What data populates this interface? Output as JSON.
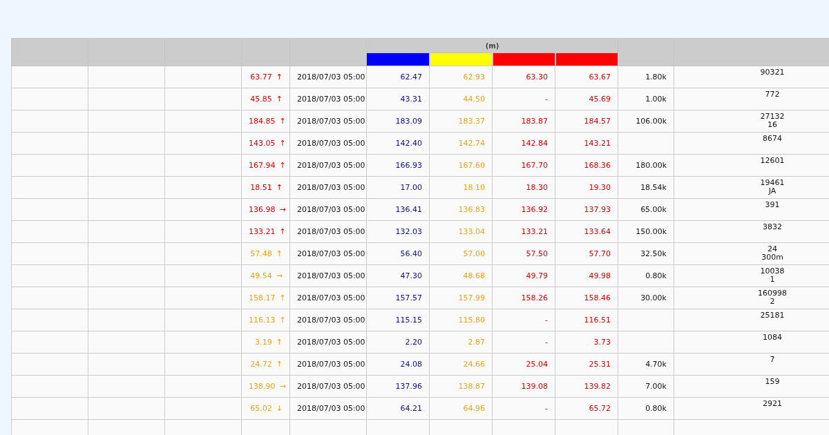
{
  "table": {
    "unit_header": "(m)",
    "thresholds": [
      {
        "color": "#0000ff"
      },
      {
        "color": "#ffff00"
      },
      {
        "color": "#ff0000"
      },
      {
        "color": "#ff0000"
      }
    ],
    "rows": [
      {
        "level_value": "63.77",
        "trend": "↑",
        "color": "#cc0000",
        "time": "2018/07/03 05:00",
        "t1": "62.47",
        "t2": "62.93",
        "t3": "63.30",
        "t4": "63.67",
        "amount": "1.80k",
        "code": [
          "90321"
        ]
      },
      {
        "level_value": "45.85",
        "trend": "↑",
        "color": "#cc0000",
        "time": "2018/07/03 05:00",
        "t1": "43.31",
        "t2": "44.50",
        "t3": "-",
        "t4": "45.69",
        "amount": "1.00k",
        "code": [
          "772"
        ]
      },
      {
        "level_value": "184.85",
        "trend": "↑",
        "color": "#cc0000",
        "time": "2018/07/03 05:00",
        "t1": "183.09",
        "t2": "183.37",
        "t3": "183.87",
        "t4": "184.57",
        "amount": "106.00k",
        "code": [
          "27132",
          "16"
        ]
      },
      {
        "level_value": "143.05",
        "trend": "↑",
        "color": "#cc0000",
        "time": "2018/07/03 05:00",
        "t1": "142.40",
        "t2": "142.74",
        "t3": "142.84",
        "t4": "143.21",
        "code": [
          "8674"
        ]
      },
      {
        "level_value": "167.94",
        "trend": "↑",
        "color": "#cc0000",
        "time": "2018/07/03 05:00",
        "t1": "166.93",
        "t2": "167.60",
        "t3": "167.70",
        "t4": "168.36",
        "amount": "180.00k",
        "code": [
          "12601"
        ]
      },
      {
        "level_value": "18.51",
        "trend": "↑",
        "color": "#cc0000",
        "time": "2018/07/03 05:00",
        "t1": "17.00",
        "t2": "18.10",
        "t3": "18.30",
        "t4": "19.30",
        "amount": "18.54k",
        "code": [
          "19461",
          "JA"
        ]
      },
      {
        "level_value": "136.98",
        "trend": "→",
        "color": "#cc0000",
        "time": "2018/07/03 05:00",
        "t1": "136.41",
        "t2": "136.83",
        "t3": "136.92",
        "t4": "137.93",
        "amount": "65.00k",
        "code": [
          "391"
        ]
      },
      {
        "level_value": "133.21",
        "trend": "↑",
        "color": "#cc0000",
        "time": "2018/07/03 05:00",
        "t1": "132.03",
        "t2": "133.04",
        "t3": "133.21",
        "t4": "133.64",
        "amount": "150.00k",
        "code": [
          "3832"
        ]
      },
      {
        "level_value": "57.48",
        "trend": "↑",
        "color": "#e8a317",
        "time": "2018/07/03 05:00",
        "t1": "56.40",
        "t2": "57.00",
        "t3": "57.50",
        "t4": "57.70",
        "amount": "32.50k",
        "code": [
          "24",
          "300m"
        ]
      },
      {
        "level_value": "49.54",
        "trend": "→",
        "color": "#e8a317",
        "time": "2018/07/03 05:00",
        "t1": "47.30",
        "t2": "48.68",
        "t3": "49.79",
        "t4": "49.98",
        "amount": "0.80k",
        "code": [
          "10038",
          "1"
        ]
      },
      {
        "level_value": "158.17",
        "trend": "↑",
        "color": "#e8a317",
        "time": "2018/07/03 05:00",
        "t1": "157.57",
        "t2": "157.99",
        "t3": "158.26",
        "t4": "158.46",
        "amount": "30.00k",
        "code": [
          "160998",
          "2"
        ]
      },
      {
        "level_value": "116.13",
        "trend": "↑",
        "color": "#e8a317",
        "time": "2018/07/03 05:00",
        "t1": "115.15",
        "t2": "115.80",
        "t3": "-",
        "t4": "116.51",
        "code": [
          "25181"
        ]
      },
      {
        "level_value": "3.19",
        "trend": "↑",
        "color": "#e8a317",
        "time": "2018/07/03 05:00",
        "t1": "2.20",
        "t2": "2.87",
        "t3": "-",
        "t4": "3.73",
        "code": [
          "1084"
        ]
      },
      {
        "level_value": "24.72",
        "trend": "↑",
        "color": "#e8a317",
        "time": "2018/07/03 05:00",
        "t1": "24.08",
        "t2": "24.66",
        "t3": "25.04",
        "t4": "25.31",
        "amount": "4.70k",
        "code": [
          "7"
        ]
      },
      {
        "level_value": "138.90",
        "trend": "→",
        "color": "#e8a317",
        "time": "2018/07/03 05:00",
        "t1": "137.96",
        "t2": "138.87",
        "t3": "139.08",
        "t4": "139.82",
        "amount": "7.00k",
        "code": [
          "159"
        ]
      },
      {
        "level_value": "65.02",
        "trend": "↓",
        "color": "#e8a317",
        "time": "2018/07/03 05:00",
        "t1": "64.21",
        "t2": "64.96",
        "t3": "-",
        "t4": "65.72",
        "amount": "0.80k",
        "code": [
          "2921"
        ]
      }
    ]
  }
}
